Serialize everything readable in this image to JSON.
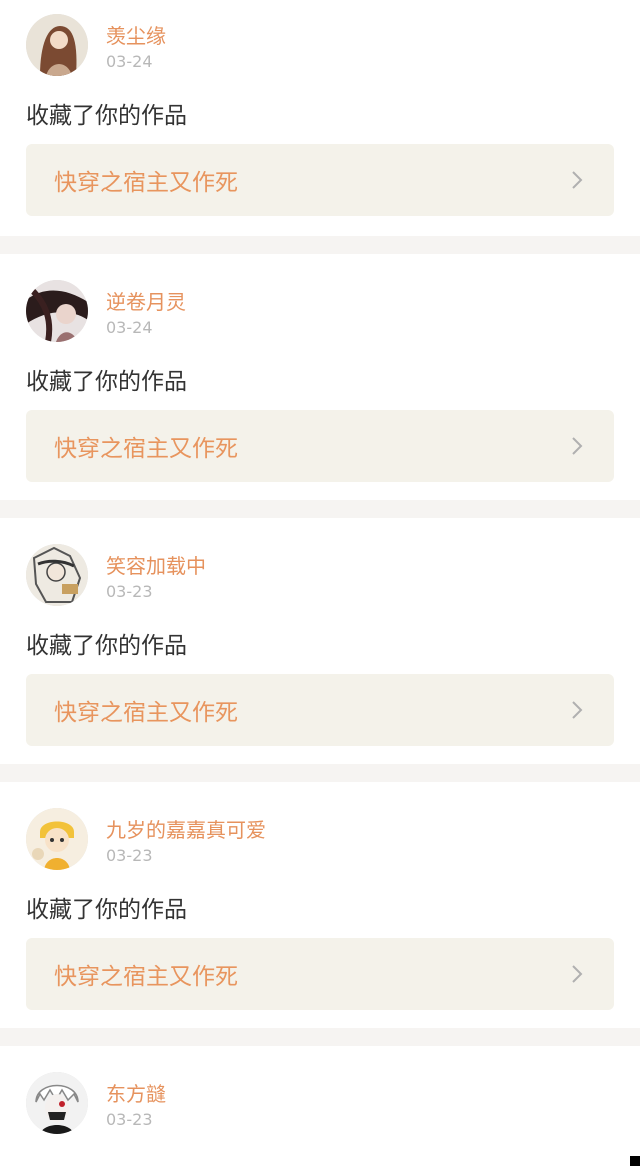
{
  "notifications": [
    {
      "username": "羡尘缘",
      "date": "03-24",
      "action": "收藏了你的作品",
      "work_title": "快穿之宿主又作死",
      "avatar_icon": "avatar-girl-brown-hair"
    },
    {
      "username": "逆卷月灵",
      "date": "03-24",
      "action": "收藏了你的作品",
      "work_title": "快穿之宿主又作死",
      "avatar_icon": "avatar-dark-hair-portrait"
    },
    {
      "username": "笑容加载中",
      "date": "03-23",
      "action": "收藏了你的作品",
      "work_title": "快穿之宿主又作死",
      "avatar_icon": "avatar-sketch-portrait"
    },
    {
      "username": "九岁的嘉嘉真可爱",
      "date": "03-23",
      "action": "收藏了你的作品",
      "work_title": "快穿之宿主又作死",
      "avatar_icon": "avatar-yellow-cartoon"
    },
    {
      "username": "东方韼",
      "date": "03-23",
      "avatar_icon": "avatar-white-hair-mask"
    }
  ],
  "colors": {
    "username": "#e6925d",
    "work_title": "#e8955e",
    "work_bg": "#f4f2ea",
    "page_bg": "#f6f4f2"
  }
}
